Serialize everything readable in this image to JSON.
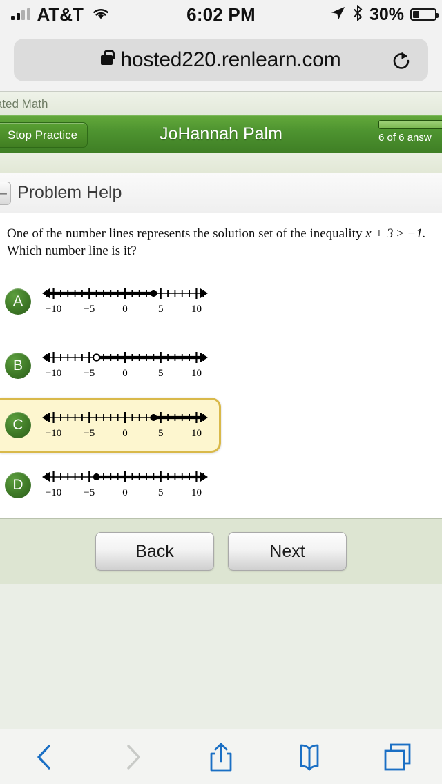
{
  "status_bar": {
    "carrier": "AT&T",
    "time": "6:02 PM",
    "battery_percent": "30%",
    "signal_icon": "signal-bars-icon",
    "wifi_icon": "wifi-icon",
    "location_icon": "location-arrow-icon",
    "bluetooth_icon": "bluetooth-icon",
    "battery_icon": "battery-icon"
  },
  "browser": {
    "url": "hosted220.renlearn.com",
    "lock_icon": "lock-icon",
    "reload_icon": "reload-icon",
    "toolbar": {
      "back_icon": "back-chevron-icon",
      "forward_icon": "forward-chevron-icon",
      "share_icon": "share-icon",
      "bookmarks_icon": "bookmarks-book-icon",
      "tabs_icon": "tabs-icon"
    }
  },
  "app": {
    "title": "celerated Math",
    "stop_practice_label": "Stop Practice",
    "student_name": "JoHannah Palm",
    "progress_label": "6 of 6 answ",
    "progress_percent": 100,
    "collapse_glyph": "–",
    "problem_help_label": "Problem Help"
  },
  "question": {
    "text_before": "One of the number lines represents the solution set of the inequality ",
    "expression": "x + 3 ≥ −1.",
    "text_after": " Which number line is it?"
  },
  "choices": [
    {
      "letter": "A",
      "selected": false,
      "point": 4,
      "closed": true,
      "direction": "left",
      "tick_labels": [
        "−10",
        "−5",
        "0",
        "5",
        "10"
      ]
    },
    {
      "letter": "B",
      "selected": false,
      "point": -4,
      "closed": false,
      "direction": "right",
      "tick_labels": [
        "−10",
        "−5",
        "0",
        "5",
        "10"
      ]
    },
    {
      "letter": "C",
      "selected": true,
      "point": 4,
      "closed": true,
      "direction": "right",
      "tick_labels": [
        "−10",
        "−5",
        "0",
        "5",
        "10"
      ]
    },
    {
      "letter": "D",
      "selected": false,
      "point": -4,
      "closed": true,
      "direction": "right",
      "tick_labels": [
        "−10",
        "−5",
        "0",
        "5",
        "10"
      ]
    }
  ],
  "footer": {
    "back_label": "Back",
    "next_label": "Next"
  },
  "colors": {
    "header_green": "#4e9430",
    "selected_fill": "#fdf6cf",
    "selected_border": "#d9b94a",
    "footer_bg": "#dde5d2",
    "safari_blue": "#1a6fc4"
  }
}
